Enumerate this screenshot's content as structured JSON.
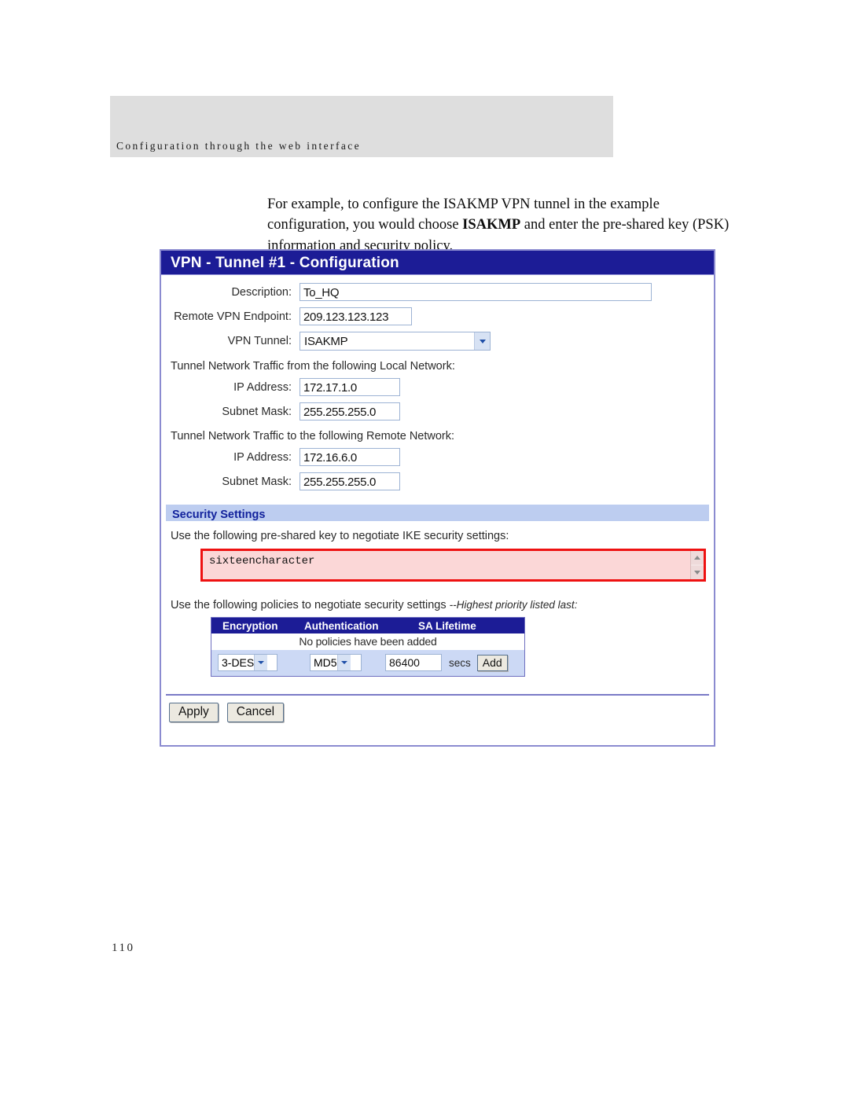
{
  "document": {
    "running_header": "Configuration through the web interface",
    "page_number": "110",
    "paragraph": {
      "part1": "For example, to configure the ISAKMP VPN tunnel in the example configuration, you would choose ",
      "bold": "ISAKMP",
      "part2": " and enter the pre-shared key (PSK) information and security policy."
    }
  },
  "colors": {
    "titlebar": "#1c1c96",
    "panel_border": "#8b8bd0",
    "section_bar_bg": "#bdcdf0",
    "section_bar_text": "#12229c",
    "psk_highlight_border": "#ee1111",
    "psk_highlight_bg": "#fbd7d7",
    "table_header_bg": "#1c1c96",
    "controls_row_bg": "#ccd9f5",
    "header_band_bg": "#dedede"
  },
  "panel": {
    "title": "VPN - Tunnel #1 - Configuration",
    "fields": {
      "description": {
        "label": "Description:",
        "value": "To_HQ"
      },
      "remote_endpoint": {
        "label": "Remote VPN Endpoint:",
        "value": "209.123.123.123"
      },
      "vpn_tunnel": {
        "label": "VPN Tunnel:",
        "value": "ISAKMP",
        "arrow_icon": "chevron-down-icon"
      }
    },
    "local_network": {
      "note": "Tunnel Network Traffic from the following Local Network:",
      "ip_address": {
        "label": "IP Address:",
        "value": "172.17.1.0"
      },
      "subnet_mask": {
        "label": "Subnet Mask:",
        "value": "255.255.255.0"
      }
    },
    "remote_network": {
      "note": "Tunnel Network Traffic to the following Remote Network:",
      "ip_address": {
        "label": "IP Address:",
        "value": "172.16.6.0"
      },
      "subnet_mask": {
        "label": "Subnet Mask:",
        "value": "255.255.255.0"
      }
    },
    "security_settings": {
      "section_title": "Security Settings",
      "psk_note": "Use the following pre-shared key to negotiate IKE security settings:",
      "psk_value": "sixteencharacter",
      "scroll_up_icon": "chevron-up-icon",
      "scroll_down_icon": "chevron-down-icon"
    },
    "policies": {
      "note_plain": "Use the following policies to negotiate security settings ",
      "note_italic": "--Highest priority listed last:",
      "columns": [
        "Encryption",
        "Authentication",
        "SA Lifetime"
      ],
      "empty_message": "No policies have been added",
      "encryption_value": "3-DES",
      "authentication_value": "MD5",
      "sa_lifetime_value": "86400",
      "sa_units_label": "secs",
      "add_button_label": "Add"
    },
    "actions": {
      "apply_label": "Apply",
      "cancel_label": "Cancel"
    }
  }
}
